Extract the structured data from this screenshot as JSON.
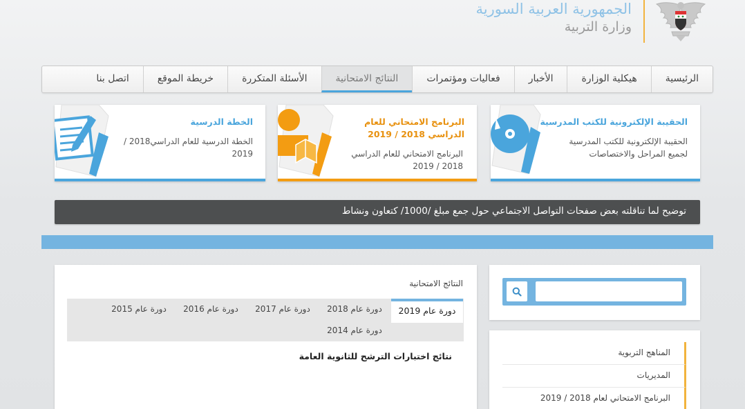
{
  "header": {
    "country": "الجمهورية العربية السورية",
    "ministry": "وزارة التربية",
    "emblem_icon": "syrian-eagle-emblem-icon"
  },
  "nav": {
    "items": [
      {
        "label": "الرئيسية",
        "active": false
      },
      {
        "label": "هيكلية الوزارة",
        "active": false
      },
      {
        "label": "الأخبار",
        "active": false
      },
      {
        "label": "فعاليات ومؤتمرات",
        "active": false
      },
      {
        "label": "النتائج الامتحانية",
        "active": true
      },
      {
        "label": "الأسئلة المتكررة",
        "active": false
      },
      {
        "label": "خريطة الموقع",
        "active": false
      },
      {
        "label": "اتصل بنا",
        "active": false
      }
    ]
  },
  "cards": [
    {
      "title": "الحقيبة الإلكترونية للكتب المدرسية",
      "text": [
        "الحقيبة الإلكترونية للكتب المدرسية",
        "لجميع المراحل والاختصاصات"
      ],
      "icon": "disc-document-icon",
      "color": "#4aa5dc"
    },
    {
      "title": [
        "البرنامج الامتحاني للعام",
        "الدراسي 2018 / 2019"
      ],
      "text": [
        "البرنامج الامتحاني للعام الدراسي",
        "2018 / 2019"
      ],
      "icon": "student-reading-icon",
      "color": "#f39c12"
    },
    {
      "title": "الخطة الدرسية",
      "text": [
        "الخطة الدرسية للعام الدراسي2018 /",
        "2019"
      ],
      "icon": "document-pen-icon",
      "color": "#4aa5dc"
    }
  ],
  "ticker": {
    "text": "توضيح لما تناقلته بعض صفحات التواصل الاجتماعي حول جمع مبلغ /1000/ كتعاون ونشاط"
  },
  "results": {
    "heading": "النتائج الامتحانية",
    "tabs": [
      {
        "label": "دورة عام 2019",
        "active": true
      },
      {
        "label": "دورة عام 2018",
        "active": false
      },
      {
        "label": "دورة عام 2017",
        "active": false
      },
      {
        "label": "دورة عام 2016",
        "active": false
      },
      {
        "label": "دورة عام 2015",
        "active": false
      },
      {
        "label": "دورة عام 2014",
        "active": false
      }
    ],
    "link": "نتائج اختبارات الترشح للثانوية العامة"
  },
  "search": {
    "placeholder": "",
    "icon": "search-icon"
  },
  "sidebar_links": [
    {
      "label": "المناهج التربوية"
    },
    {
      "label": "المديريات"
    },
    {
      "label": "البرنامج الامتحاني لعام 2018 / 2019"
    }
  ],
  "colors": {
    "accent_blue": "#74b4e0",
    "accent_orange": "#f2b33d",
    "ticker_bg": "#4d4f50"
  }
}
